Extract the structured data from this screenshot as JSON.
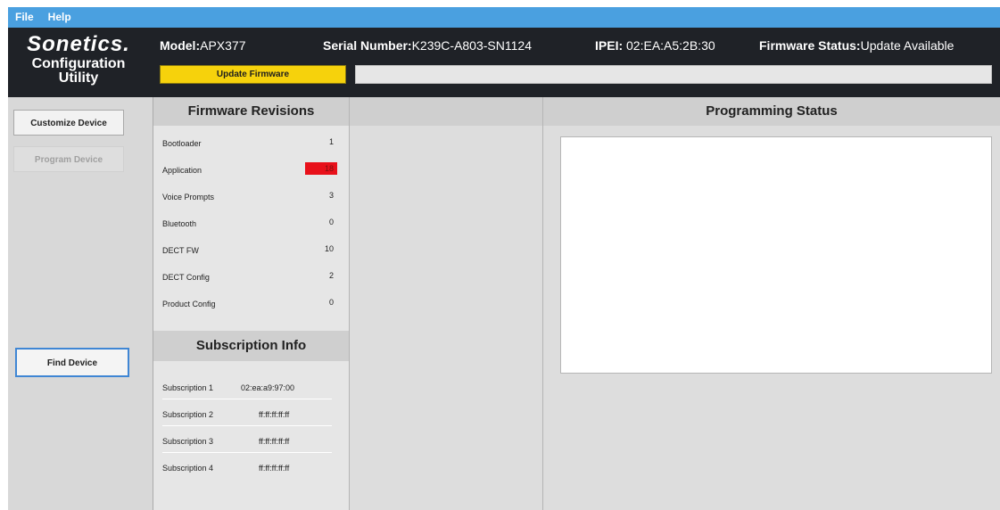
{
  "menu": {
    "items": [
      "File",
      "Help"
    ]
  },
  "brand": {
    "name": "Sonetics.",
    "subtitle_line1": "Configuration",
    "subtitle_line2": "Utility"
  },
  "device": {
    "model_label": "Model:",
    "model_value": "APX377",
    "serial_label": "Serial Number:",
    "serial_value": "K239C-A803-SN1124",
    "ipei_label": "IPEI:",
    "ipei_value": "02:EA:A5:2B:30",
    "fw_status_label": "Firmware Status:",
    "fw_status_value": "Update Available"
  },
  "update_button": "Update Firmware",
  "sidebar": {
    "customize": "Customize Device",
    "program": "Program Device",
    "find": "Find Device"
  },
  "firmware": {
    "title": "Firmware Revisions",
    "rows": [
      {
        "label": "Bootloader",
        "value": "1"
      },
      {
        "label": "Application",
        "value": "18"
      },
      {
        "label": "Voice Prompts",
        "value": "3"
      },
      {
        "label": "Bluetooth",
        "value": "0"
      },
      {
        "label": "DECT FW",
        "value": "10"
      },
      {
        "label": "DECT Config",
        "value": "2"
      },
      {
        "label": "Product Config",
        "value": "0"
      }
    ]
  },
  "subscription": {
    "title": "Subscription Info",
    "rows": [
      {
        "label": "Subscription 1",
        "value": "02:ea:a9:97:00"
      },
      {
        "label": "Subscription 2",
        "value": "ff:ff:ff:ff:ff"
      },
      {
        "label": "Subscription 3",
        "value": "ff:ff:ff:ff:ff"
      },
      {
        "label": "Subscription 4",
        "value": "ff:ff:ff:ff:ff"
      }
    ]
  },
  "programming": {
    "title": "Programming Status"
  },
  "colors": {
    "accent": "#4aa0e0",
    "header_bg": "#1f2227",
    "update_button": "#f6d20c",
    "alert": "#e8101a"
  }
}
